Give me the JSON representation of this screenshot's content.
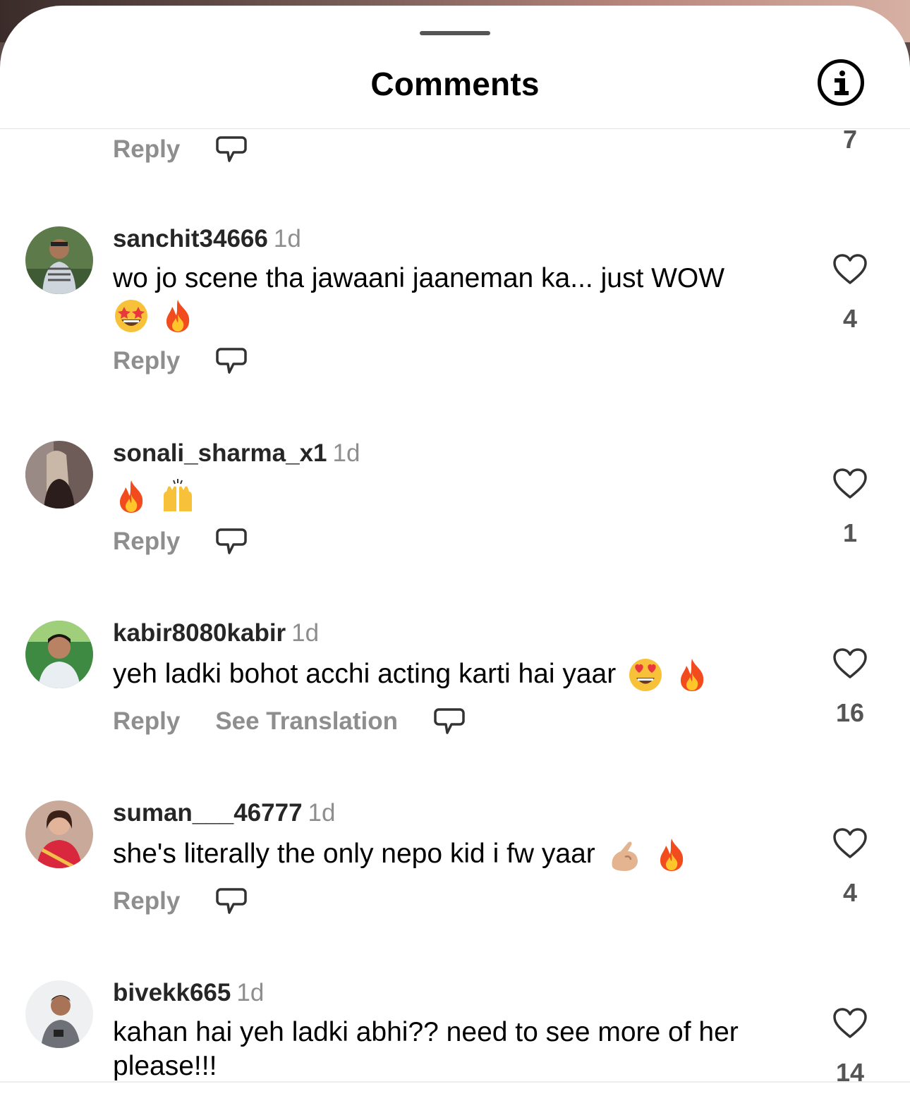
{
  "header": {
    "title": "Comments",
    "info_icon": "info-icon"
  },
  "partial_top": {
    "reply": "Reply",
    "count": "7"
  },
  "comments": [
    {
      "username": "sanchit34666",
      "time": "1d",
      "text": "wo jo scene tha jawaani jaaneman ka... just WOW",
      "emojis": [
        "star-struck",
        "fire"
      ],
      "reply": "Reply",
      "likes": "4"
    },
    {
      "username": "sonali_sharma_x1",
      "time": "1d",
      "text": "",
      "emojis": [
        "fire",
        "raising-hands"
      ],
      "reply": "Reply",
      "likes": "1"
    },
    {
      "username": "kabir8080kabir",
      "time": "1d",
      "text": "yeh ladki bohot acchi acting karti hai yaar",
      "emojis": [
        "heart-eyes",
        "fire"
      ],
      "reply": "Reply",
      "translate": "See Translation",
      "likes": "16"
    },
    {
      "username": "suman___46777",
      "time": "1d",
      "text": "she's literally the only nepo kid i fw yaar",
      "emojis": [
        "pinching-hand",
        "fire"
      ],
      "reply": "Reply",
      "likes": "4"
    },
    {
      "username": "bivekk665",
      "time": "1d",
      "text": "kahan hai yeh ladki abhi?? need to see more of her please!!!",
      "emojis": [],
      "likes": "14"
    }
  ]
}
